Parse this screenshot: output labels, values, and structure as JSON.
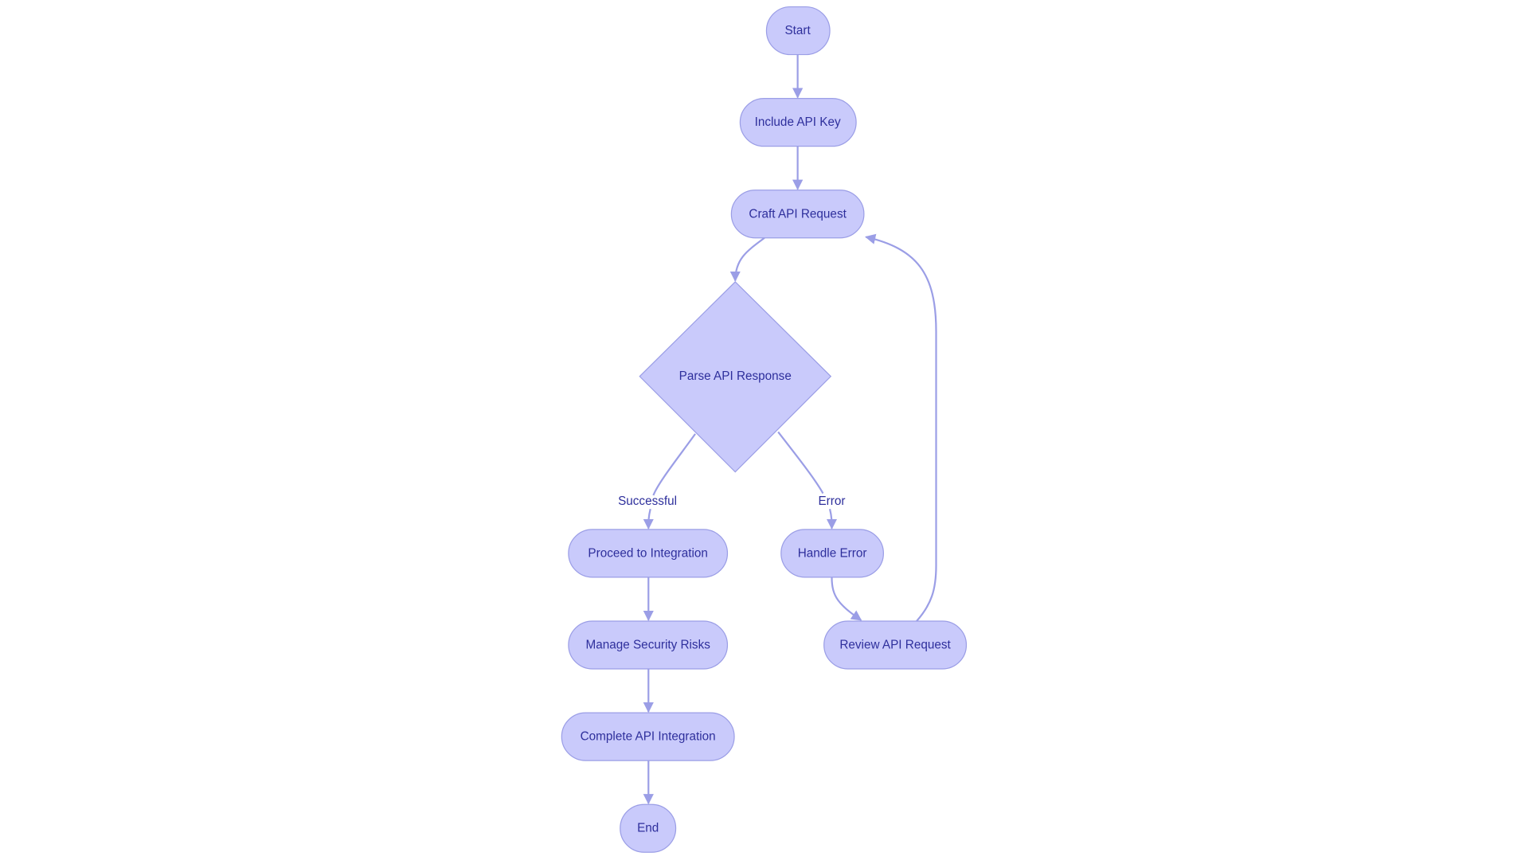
{
  "colors": {
    "node_fill": "#c9cafb",
    "node_stroke": "#9b9ee6",
    "text": "#2e2f9c",
    "edge": "#9b9ee6"
  },
  "nodes": {
    "start": "Start",
    "include_key": "Include API Key",
    "craft_request": "Craft API Request",
    "parse_response": "Parse API Response",
    "proceed": "Proceed to Integration",
    "handle_error": "Handle Error",
    "manage_risks": "Manage Security Risks",
    "review_request": "Review API Request",
    "complete": "Complete API Integration",
    "end": "End"
  },
  "edges": {
    "successful": "Successful",
    "error": "Error"
  }
}
